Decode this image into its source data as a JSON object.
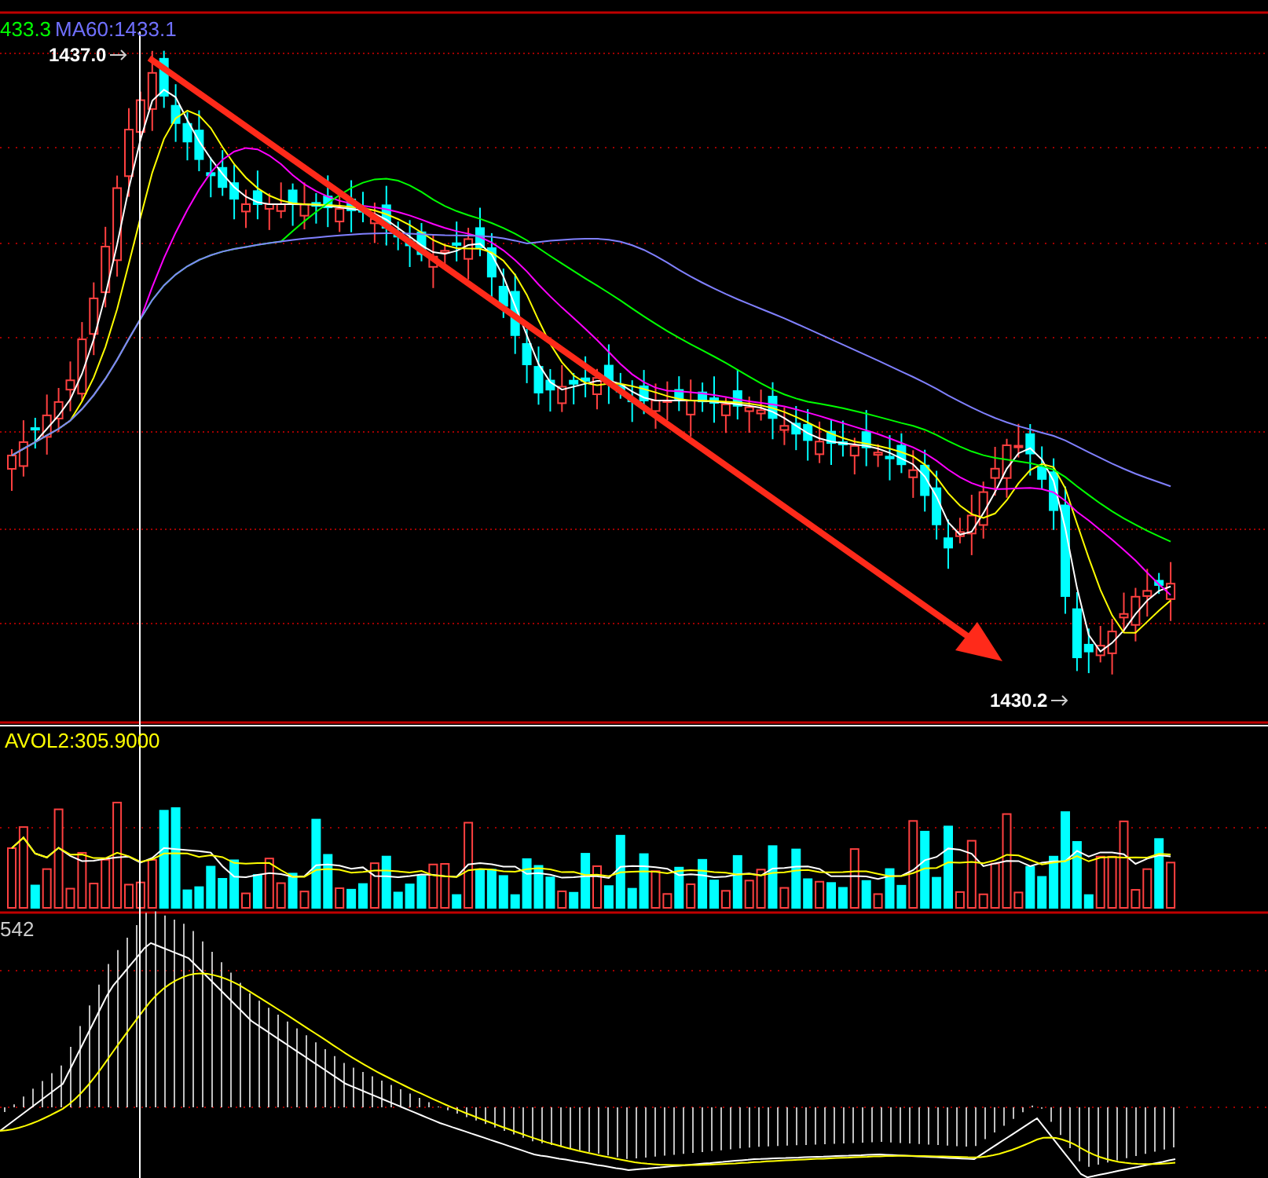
{
  "main_panel": {
    "legend": [
      {
        "text": "433.3",
        "color": "#00ff00"
      },
      {
        "text": "MA60:1433.1",
        "color": "#7070ff"
      }
    ],
    "high_label": "1437.0",
    "low_label": "1430.2"
  },
  "volume_panel": {
    "legend": "AVOL2:305.9000"
  },
  "macd_panel": {
    "legend": "542"
  }
}
